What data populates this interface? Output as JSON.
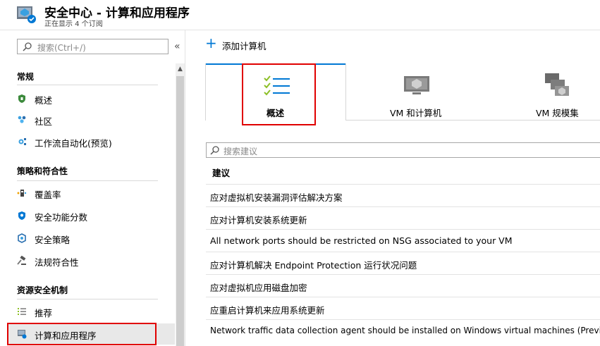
{
  "header": {
    "title": "安全中心 - 计算和应用程序",
    "subtitle": "正在显示 4 个订阅"
  },
  "sidebar": {
    "search_placeholder": "搜索(Ctrl+/)",
    "collapse_glyph": "«",
    "sections": [
      {
        "title": "常规",
        "items": [
          {
            "label": "概述",
            "icon": "shield-icon"
          },
          {
            "label": "社区",
            "icon": "community-icon"
          },
          {
            "label": "工作流自动化(预览)",
            "icon": "workflow-icon"
          }
        ]
      },
      {
        "title": "策略和符合性",
        "items": [
          {
            "label": "覆盖率",
            "icon": "coverage-icon"
          },
          {
            "label": "安全功能分数",
            "icon": "secure-score-icon"
          },
          {
            "label": "安全策略",
            "icon": "policy-icon"
          },
          {
            "label": "法规符合性",
            "icon": "compliance-icon"
          }
        ]
      },
      {
        "title": "资源安全机制",
        "items": [
          {
            "label": "推荐",
            "icon": "list-icon"
          },
          {
            "label": "计算和应用程序",
            "icon": "compute-icon",
            "active": true
          }
        ]
      }
    ]
  },
  "main": {
    "add_button_label": "添加计算机",
    "tabs": [
      {
        "label": "概述",
        "icon": "checklist-icon",
        "selected": true
      },
      {
        "label": "VM 和计算机",
        "icon": "vm-icon"
      },
      {
        "label": "VM 规模集",
        "icon": "vmss-icon"
      }
    ],
    "search_placeholder": "搜索建议",
    "column_header": "建议",
    "recommendations": [
      "应对虚拟机安装漏洞评估解决方案",
      "应对计算机安装系统更新",
      "All network ports should be restricted on NSG associated to your VM",
      "应对计算机解决 Endpoint Protection 运行状况问题",
      "应对虚拟机应用磁盘加密",
      "应重启计算机来应用系统更新",
      "Network traffic data collection agent should be installed on Windows virtual machines (Preview)"
    ]
  },
  "colors": {
    "accent": "#0078d4",
    "highlight_border": "#e00000"
  }
}
